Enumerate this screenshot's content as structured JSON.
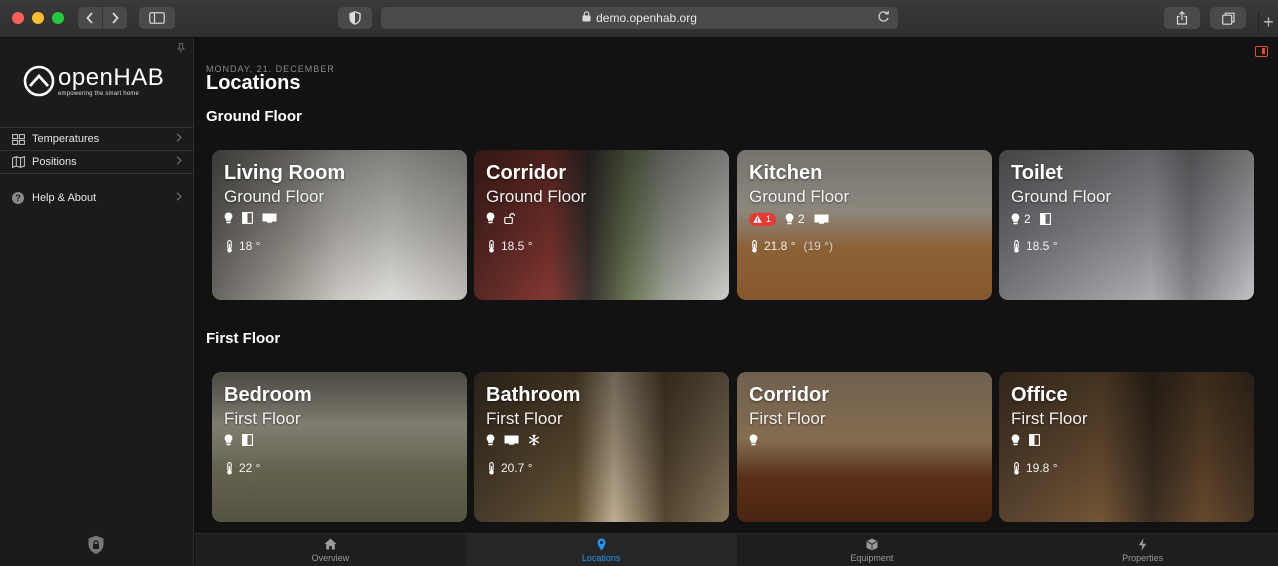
{
  "browser": {
    "url": "demo.openhab.org",
    "icons": {
      "back": "chevron-left-icon",
      "forward": "chevron-right-icon",
      "sidebar": "sidebar-icon",
      "shield": "privacy-shield-icon",
      "lock": "lock-icon",
      "reload": "reload-icon",
      "share": "share-icon",
      "tabs": "tabs-icon",
      "new_tab": "plus-icon"
    },
    "new_tab_glyph": "+"
  },
  "sidebar": {
    "logo_word": "openHAB",
    "logo_tagline": "empowering the smart home",
    "items": [
      {
        "label": "Temperatures",
        "icon": "grid-icon"
      },
      {
        "label": "Positions",
        "icon": "map-icon"
      }
    ],
    "help": {
      "label": "Help & About",
      "icon": "help-circle-icon",
      "glyph": "?"
    },
    "footer_icon": "admin-shield-icon"
  },
  "header": {
    "date": "MONDAY, 21. DECEMBER",
    "title": "Locations"
  },
  "floors": [
    {
      "title": "Ground Floor",
      "rooms": [
        {
          "name": "Living Room",
          "floor": "Ground Floor",
          "temp": "18 °",
          "bg": "living"
        },
        {
          "name": "Corridor",
          "floor": "Ground Floor",
          "temp": "18.5 °",
          "bg": "corr1"
        },
        {
          "name": "Kitchen",
          "floor": "Ground Floor",
          "alert_count": "1",
          "light_count": "2",
          "temp": "21.8 °",
          "target": "(19 °)",
          "bg": "kitchen"
        },
        {
          "name": "Toilet",
          "floor": "Ground Floor",
          "light_count": "2",
          "temp": "18.5 °",
          "bg": "toilet"
        }
      ]
    },
    {
      "title": "First Floor",
      "rooms": [
        {
          "name": "Bedroom",
          "floor": "First Floor",
          "temp": "22 °",
          "bg": "bedroom"
        },
        {
          "name": "Bathroom",
          "floor": "First Floor",
          "temp": "20.7 °",
          "bg": "bath"
        },
        {
          "name": "Corridor",
          "floor": "First Floor",
          "bg": "corr2"
        },
        {
          "name": "Office",
          "floor": "First Floor",
          "temp": "19.8 °",
          "bg": "office"
        }
      ]
    }
  ],
  "tabbar": {
    "tabs": [
      {
        "label": "Overview",
        "icon": "house-icon",
        "active": false
      },
      {
        "label": "Locations",
        "icon": "location-pin-icon",
        "active": true
      },
      {
        "label": "Equipment",
        "icon": "cube-icon",
        "active": false
      },
      {
        "label": "Properties",
        "icon": "bolt-icon",
        "active": false
      }
    ]
  },
  "colors": {
    "accent": "#2196f3",
    "alert": "#e53935",
    "panel_toggle": "#e0502a",
    "background": "#121212",
    "sidebar": "#1b1b1b"
  }
}
